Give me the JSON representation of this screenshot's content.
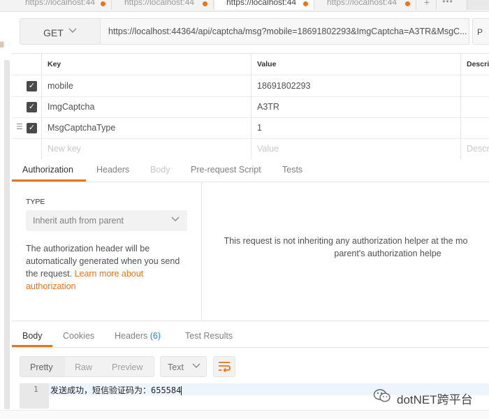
{
  "tabs": [
    {
      "label": "https://localhost:44"
    },
    {
      "label": "https://localhost:44"
    },
    {
      "label": "https://localhost:44"
    },
    {
      "label": "https://localhost:44"
    }
  ],
  "tab_controls": {
    "add": "+",
    "more": "•••"
  },
  "request": {
    "method": "GET",
    "url": "https://localhost:44364/api/captcha/msg?mobile=18691802293&ImgCaptcha=A3TR&MsgC...",
    "params_button": "P"
  },
  "params": {
    "headers": {
      "key": "Key",
      "value": "Value",
      "description": "Descrip"
    },
    "rows": [
      {
        "key": "mobile",
        "value": "18691802293"
      },
      {
        "key": "ImgCaptcha",
        "value": "A3TR"
      },
      {
        "key": "MsgCaptchaType",
        "value": "1"
      }
    ],
    "new_row": {
      "key_placeholder": "New key",
      "value_placeholder": "Value",
      "desc_placeholder": "Descr"
    }
  },
  "request_tabs": [
    "Authorization",
    "Headers",
    "Body",
    "Pre-request Script",
    "Tests"
  ],
  "auth": {
    "type_label": "TYPE",
    "type_value": "Inherit auth from parent",
    "description": "The authorization header will be automatically generated when you send the request.",
    "learn_more": "Learn more about authorization",
    "message_line1": "This request is not inheriting any authorization helper at the mo",
    "message_line2": "parent's authorization helpe"
  },
  "response_tabs": {
    "body": "Body",
    "cookies": "Cookies",
    "headers": "Headers",
    "headers_count": "(6)",
    "test_results": "Test Results"
  },
  "response_view": {
    "formats": [
      "Pretty",
      "Raw",
      "Preview"
    ],
    "language": "Text"
  },
  "response_body": {
    "line_number": "1",
    "text": "发送成功，短信验证码为：655584"
  },
  "watermark": "dotNET跨平台",
  "colors": {
    "accent": "#e8741d",
    "count": "#2f7ec8"
  }
}
